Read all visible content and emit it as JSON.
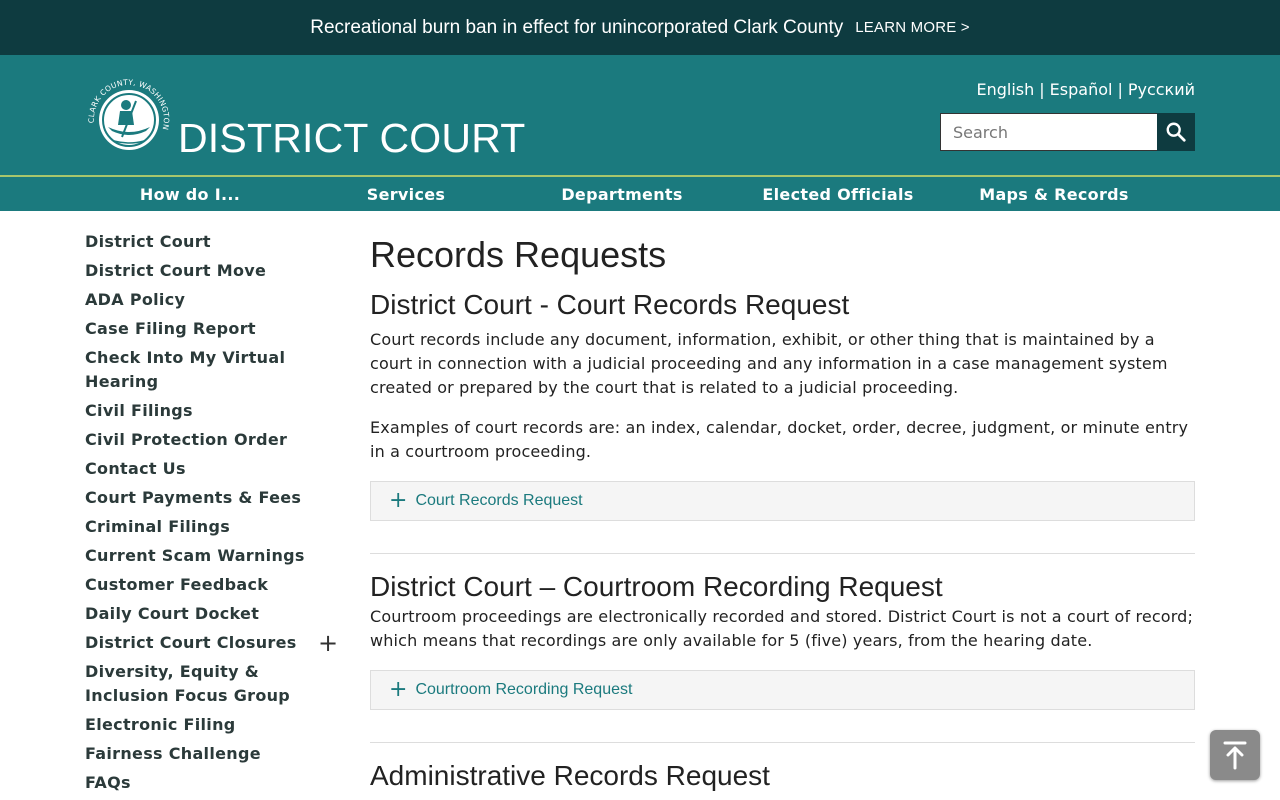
{
  "alert": {
    "text": "Recreational burn ban in effect for unincorporated Clark County",
    "link_label": "LEARN MORE >"
  },
  "header": {
    "seal_text": "CLARK COUNTY, WASHINGTON",
    "site_title": "DISTRICT COURT",
    "languages": [
      "English",
      "Español",
      "Русский"
    ],
    "search_placeholder": "Search"
  },
  "nav": {
    "items": [
      "How do I...",
      "Services",
      "Departments",
      "Elected Officials",
      "Maps & Records"
    ]
  },
  "sidebar": {
    "items": [
      "District Court",
      "District Court Move",
      "ADA Policy",
      "Case Filing Report",
      "Check Into My Virtual Hearing",
      "Civil Filings",
      "Civil Protection Order",
      "Contact Us",
      "Court Payments & Fees",
      "Criminal Filings",
      "Current Scam Warnings",
      "Customer Feedback",
      "Daily Court Docket",
      "District Court Closures",
      "Diversity, Equity & Inclusion Focus Group",
      "Electronic Filing",
      "Fairness Challenge",
      "FAQs"
    ],
    "expand_symbol": "+"
  },
  "main": {
    "page_title": "Records Requests",
    "sections": [
      {
        "title": "District Court - Court Records Request",
        "paragraphs": [
          "Court records include any document, information, exhibit, or other thing that is maintained by a court in connection with a judicial proceeding and any information in a case management system created or prepared by the court that is related to a judicial proceeding.",
          "Examples of court records are: an index, calendar, docket, order, decree, judgment, or minute entry in a courtroom proceeding."
        ],
        "accordion": "Court Records Request"
      },
      {
        "title": "District Court – Courtroom Recording Request",
        "paragraphs": [
          "Courtroom proceedings are electronically recorded and stored. District Court is not a court of record; which means that recordings are only available for 5 (five) years, from the hearing date."
        ],
        "accordion": "Courtroom Recording Request"
      },
      {
        "title": "Administrative Records Request"
      }
    ]
  },
  "colors": {
    "alert_bg": "#0e3b40",
    "header_bg": "#1b7a7e",
    "nav_border": "#a8c66c",
    "accent": "#1b7a7e"
  },
  "icons": {
    "search": "search-icon",
    "seal": "county-seal-icon",
    "plus": "plus-icon",
    "back_to_top": "arrow-up-icon"
  }
}
